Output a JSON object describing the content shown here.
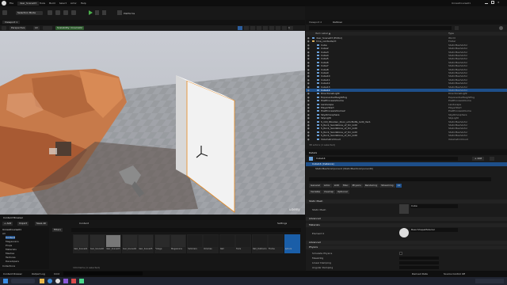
{
  "menu": {
    "items": [
      "File",
      "Edit",
      "Window",
      "Tools",
      "Build",
      "Select",
      "Actor",
      "Help"
    ],
    "project": "UnrealCourse01"
  },
  "level_tab": "desr_Scene03",
  "toolbar": {
    "mode": "Selection Mode",
    "platforms": "Platforms"
  },
  "viewport": {
    "tab": "Viewport 1",
    "view": "Perspective",
    "lit": "Lit",
    "scalability": "Scalability: Cinematic",
    "number": "1"
  },
  "outliner": {
    "tab": "Viewport 2",
    "tab2": "Outliner",
    "search_placeholder": "Search...",
    "col_label": "Item Label ▲",
    "col_type": "Type",
    "rows": [
      {
        "label": "desr_Scene03 (Editor)",
        "type": "World"
      },
      {
        "label": "Cine_vantauts/nt",
        "type": "Folder"
      },
      {
        "label": "Cube",
        "type": "StaticMeshActor"
      },
      {
        "label": "Cube2",
        "type": "StaticMeshActor"
      },
      {
        "label": "Cube3",
        "type": "StaticMeshActor"
      },
      {
        "label": "Cube4",
        "type": "StaticMeshActor"
      },
      {
        "label": "Cube5",
        "type": "StaticMeshActor"
      },
      {
        "label": "Cube6",
        "type": "StaticMeshActor"
      },
      {
        "label": "Cube7",
        "type": "StaticMeshActor"
      },
      {
        "label": "Cube8",
        "type": "StaticMeshActor"
      },
      {
        "label": "Cube9",
        "type": "StaticMeshActor"
      },
      {
        "label": "Cube10",
        "type": "StaticMeshActor"
      },
      {
        "label": "Cube11",
        "type": "StaticMeshActor"
      },
      {
        "label": "Cube12",
        "type": "StaticMeshActor"
      },
      {
        "label": "Cube13",
        "type": "StaticMeshActor"
      },
      {
        "label": "Cube14",
        "type": "StaticMeshActor"
      },
      {
        "label": "DirectionalLight",
        "type": "DirectionalLight"
      },
      {
        "label": "ExponentialHeightFog",
        "type": "ExponentialHeightFog"
      },
      {
        "label": "PostProcessVolume",
        "type": "PostProcessVolume"
      },
      {
        "label": "Landscape",
        "type": "Landscape"
      },
      {
        "label": "PlayerStart",
        "type": "PlayerStart"
      },
      {
        "label": "PostProcessVolume2",
        "type": "PostProcessVolume"
      },
      {
        "label": "SkyAtmosphere",
        "type": "SkyAtmosphere"
      },
      {
        "label": "SkyLight",
        "type": "SkyLight"
      },
      {
        "label": "S_Old_Wooden_Door_uihvfbdfa_lod0_Var1",
        "type": "StaticMeshActor"
      },
      {
        "label": "S_Rock_Sandstone_uf_tm_lod0",
        "type": "StaticMeshActor"
      },
      {
        "label": "S_Rock_Sandstone_uf_tm_lod0",
        "type": "StaticMeshActor"
      },
      {
        "label": "S_Rock_Sandstone_uf_tm_lod0",
        "type": "StaticMeshActor"
      },
      {
        "label": "S_Rock_Sandstone_uf_tm_lod0",
        "type": "StaticMeshActor"
      },
      {
        "label": "VolumetricCloud",
        "type": "VolumetricCloud"
      }
    ],
    "selected_index": 15,
    "footer": "38 actors (1 selected)"
  },
  "details": {
    "tab": "Details",
    "actor_name": "Cube14",
    "add_label": "+ Add",
    "root": "Cube14 (Instance)",
    "component": "StaticMeshComponent (StaticMeshComponent0)",
    "search_placeholder": "Search",
    "filter_tabs": [
      "General",
      "Actor",
      "LOD",
      "Misc",
      "Physics",
      "Rendering",
      "Streaming",
      "All"
    ],
    "filter_tabs2": [
      "Variable",
      "Overlap",
      "Optional"
    ],
    "sections": [
      "Static Mesh",
      "Advanced",
      "Materials",
      "Advanced",
      "Physics"
    ],
    "props": {
      "static_mesh_label": "Static Mesh",
      "static_mesh_value": "Cube",
      "element0_label": "Element 0",
      "element0_value": "BasicShapeMaterial",
      "simulate_physics": "Simulate Physics",
      "mass": "MassInKg",
      "linear_damping": "Linear Damping",
      "angular_damping": "Angular Damping"
    }
  },
  "content_browser": {
    "tab": "Content Browser",
    "add_label": "+ Add",
    "import_label": "Import",
    "save_all": "Save All",
    "path": "Content",
    "settings": "Settings",
    "search_placeholder": "Search Content",
    "filters_label": "Filters",
    "tree_root": "UnrealCourse01",
    "tree_items": [
      "All",
      "Content",
      "Megascans",
      "Props",
      "Materials",
      "Meshes",
      "Textures",
      "Developers",
      "Collections"
    ],
    "assets": [
      {
        "name": "desr_Scene01"
      },
      {
        "name": "desr_Scene02"
      },
      {
        "name": "desr_Scene03"
      },
      {
        "name": "desr_Scene04"
      },
      {
        "name": "desr_Scene05"
      },
      {
        "name": "Foliage"
      },
      {
        "name": "Megascans"
      },
      {
        "name": "Hammers"
      },
      {
        "name": "Volumes"
      },
      {
        "name": "Wall"
      },
      {
        "name": "Tools"
      },
      {
        "name": "Wall_Outdoors"
      },
      {
        "name": "Frame"
      },
      {
        "name": "Sphere"
      }
    ],
    "status": "104 items (1 selected)",
    "collections": "Collections"
  },
  "bottom": {
    "content_drawer": "Content Drawer",
    "output_log": "Output Log",
    "cmd": "Cmd",
    "console_placeholder": "Enter Console Command",
    "derived": "Derived Data",
    "source": "Source Control Off"
  },
  "watermark": "udemy",
  "colors": {
    "accent": "#1e4f8a",
    "selection_orange": "#e8881c",
    "play_green": "#4cb04c"
  }
}
